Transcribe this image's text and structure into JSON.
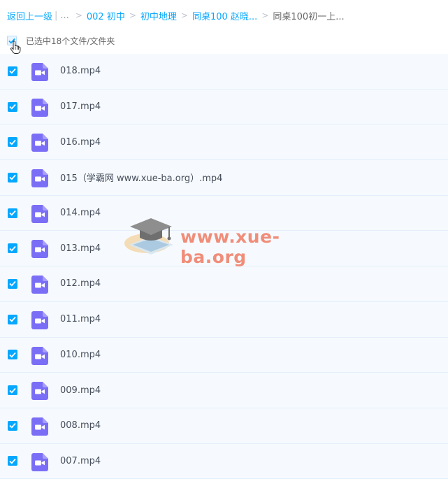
{
  "breadcrumb": {
    "back": "返回上一级",
    "ellipsis": "...",
    "items": [
      "002 初中",
      "初中地理",
      "同桌100 赵晓...",
      "同桌100初一上..."
    ]
  },
  "selection": {
    "label": "已选中18个文件/文件夹"
  },
  "files": [
    {
      "name": "018.mp4"
    },
    {
      "name": "017.mp4"
    },
    {
      "name": "016.mp4"
    },
    {
      "name": "015（学霸网 www.xue-ba.org）.mp4"
    },
    {
      "name": "014.mp4"
    },
    {
      "name": "013.mp4"
    },
    {
      "name": "012.mp4"
    },
    {
      "name": "011.mp4"
    },
    {
      "name": "010.mp4"
    },
    {
      "name": "009.mp4"
    },
    {
      "name": "008.mp4"
    },
    {
      "name": "007.mp4"
    }
  ],
  "icons": {
    "file": "video-file-icon",
    "checkbox": "checkmark-icon"
  },
  "watermark": {
    "text": "www.xue-ba.org"
  },
  "colors": {
    "link": "#06a7ff",
    "checkbox": "#06a7ff",
    "video_icon": "#7b6ef6",
    "row_bg": "#f6fafe"
  }
}
